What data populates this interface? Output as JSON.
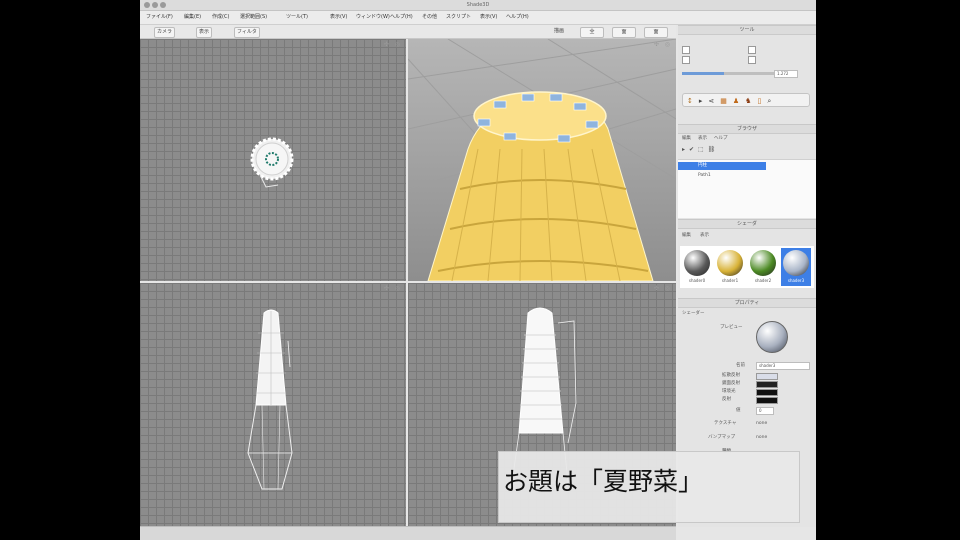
{
  "app": {
    "window_title": "Shade3D",
    "menu": [
      "ファイル(F)",
      "編集(E)",
      "作成(C)",
      "選択範囲(S)",
      "ツール(T)",
      "表示(V)",
      "ウィンドウ(W)",
      "ヘルプ(H)",
      "その他",
      "スクリプト",
      "表示(V)",
      "ヘルプ(H)"
    ]
  },
  "toolbar": {
    "camera_label": "カメラ",
    "view_label": "表示",
    "filter_label": "フィルタ",
    "render_label": "描画",
    "buttons": [
      "全",
      "面",
      "面"
    ]
  },
  "right_panel": {
    "tool_title": "ツール",
    "tool_value": "1.272",
    "browser_title": "ブラウザ",
    "browser_tabs": [
      "編集",
      "表示",
      "ヘルプ"
    ],
    "browser_items": [
      "円柱",
      "Path1"
    ],
    "shader_title": "シェーダ",
    "shader_tabs": [
      "編集",
      "表示"
    ],
    "shaders": [
      {
        "name": "shader0",
        "color": "#5a5a5a"
      },
      {
        "name": "shader1",
        "color": "#d8b236"
      },
      {
        "name": "shader2",
        "color": "#4c8a24"
      },
      {
        "name": "shader3",
        "color": "#a9b5c8"
      }
    ],
    "properties_title": "プロパティ",
    "surface_label": "シェーダー",
    "preview_label": "プレビュー",
    "name_label": "名前",
    "name_value": "shader3",
    "row_labels": [
      "拡散反射",
      "鏡面反射",
      "環境光",
      "反射"
    ],
    "value_label": "値",
    "value": "0",
    "texture_label": "テクスチャ",
    "texture_value": "none",
    "bump_label": "バンプマップ",
    "bump_value": "none",
    "normal_label": "種類"
  },
  "overlay": {
    "caption": "お題は「夏野菜」"
  }
}
